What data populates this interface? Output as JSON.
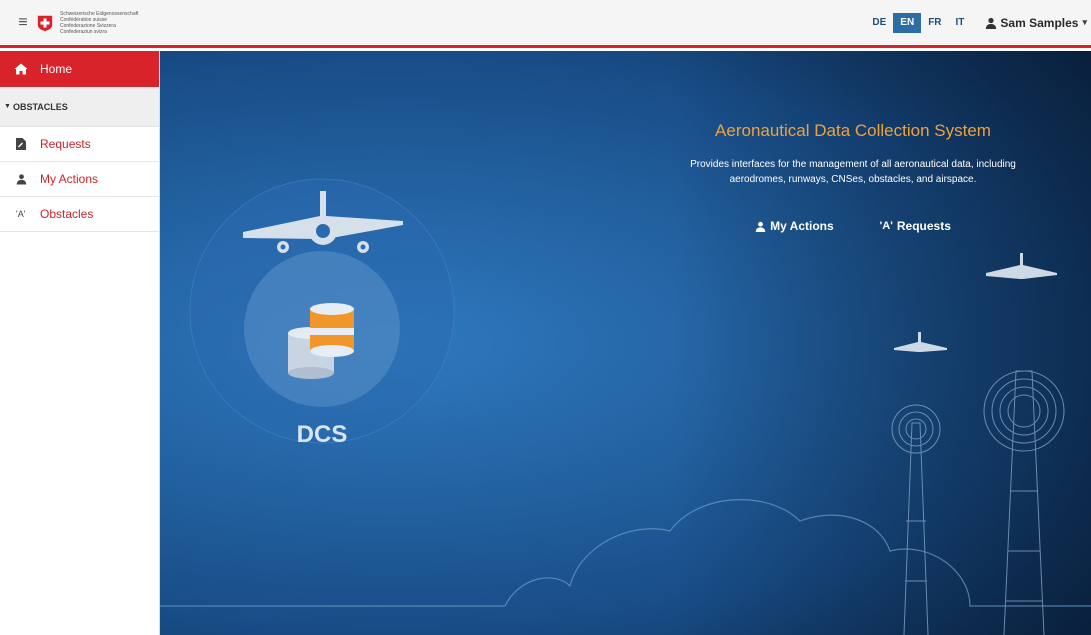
{
  "header": {
    "confederation_lines": [
      "Schweizerische Eidgenossenschaft",
      "Confédération suisse",
      "Confederazione Svizzera",
      "Confederaziun svizra"
    ],
    "languages": [
      {
        "code": "DE",
        "active": false
      },
      {
        "code": "EN",
        "active": true
      },
      {
        "code": "FR",
        "active": false
      },
      {
        "code": "IT",
        "active": false
      }
    ],
    "user_name": "Sam Samples"
  },
  "sidebar": {
    "home_label": "Home",
    "section_label": "OBSTACLES",
    "items": [
      {
        "label": "Requests",
        "icon": "document-icon"
      },
      {
        "label": "My Actions",
        "icon": "user-icon"
      },
      {
        "label": "Obstacles",
        "icon": "antenna-icon",
        "icon_text": "'A'"
      }
    ]
  },
  "hero": {
    "title": "Aeronautical Data Collection System",
    "description": "Provides interfaces for the management of all aeronautical data, including aerodromes, runways, CNSes, obstacles, and airspace.",
    "link_my_actions": "My Actions",
    "link_requests": "Requests",
    "requests_icon_text": "'A'",
    "logo_text": "DCS"
  },
  "colors": {
    "brand_red": "#d8232a",
    "title_orange": "#f0a23a",
    "active_lang": "#2e6da4"
  }
}
